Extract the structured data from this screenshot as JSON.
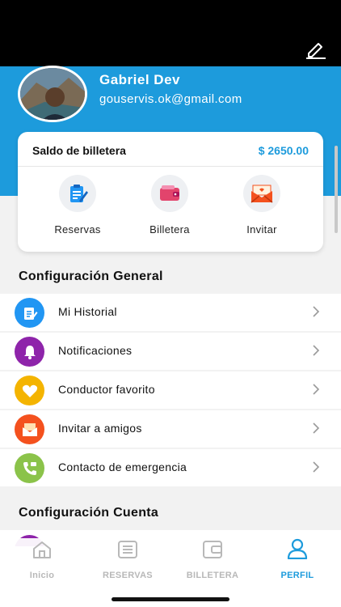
{
  "profile": {
    "name": "Gabriel Dev",
    "email": "gouservis.ok@gmail.com"
  },
  "wallet": {
    "label": "Saldo de billetera",
    "amount": "$ 2650.00"
  },
  "quick_actions": [
    {
      "label": "Reservas",
      "icon": "clipboard-icon"
    },
    {
      "label": "Billetera",
      "icon": "wallet-icon"
    },
    {
      "label": "Invitar",
      "icon": "envelope-icon"
    }
  ],
  "sections": {
    "general_title": "Configuración General",
    "account_title": "Configuración Cuenta"
  },
  "menu": [
    {
      "label": "Mi Historial",
      "icon": "clipboard-icon",
      "color": "#2196f3"
    },
    {
      "label": "Notificaciones",
      "icon": "bell-icon",
      "color": "#8e24aa"
    },
    {
      "label": "Conductor favorito",
      "icon": "heart-icon",
      "color": "#f4b400"
    },
    {
      "label": "Invitar a amigos",
      "icon": "envelope-icon",
      "color": "#f4511e"
    },
    {
      "label": "Contacto de emergencia",
      "icon": "phone-icon",
      "color": "#8bc34a"
    }
  ],
  "nav": [
    {
      "label": "Inicio",
      "icon": "home-icon",
      "active": false
    },
    {
      "label": "RESERVAS",
      "icon": "list-icon",
      "active": false
    },
    {
      "label": "BILLETERA",
      "icon": "wallet-icon",
      "active": false
    },
    {
      "label": "PERFIL",
      "icon": "user-icon",
      "active": true
    }
  ],
  "colors": {
    "accent": "#1d9bdc",
    "inactive": "#b8b8b8"
  }
}
